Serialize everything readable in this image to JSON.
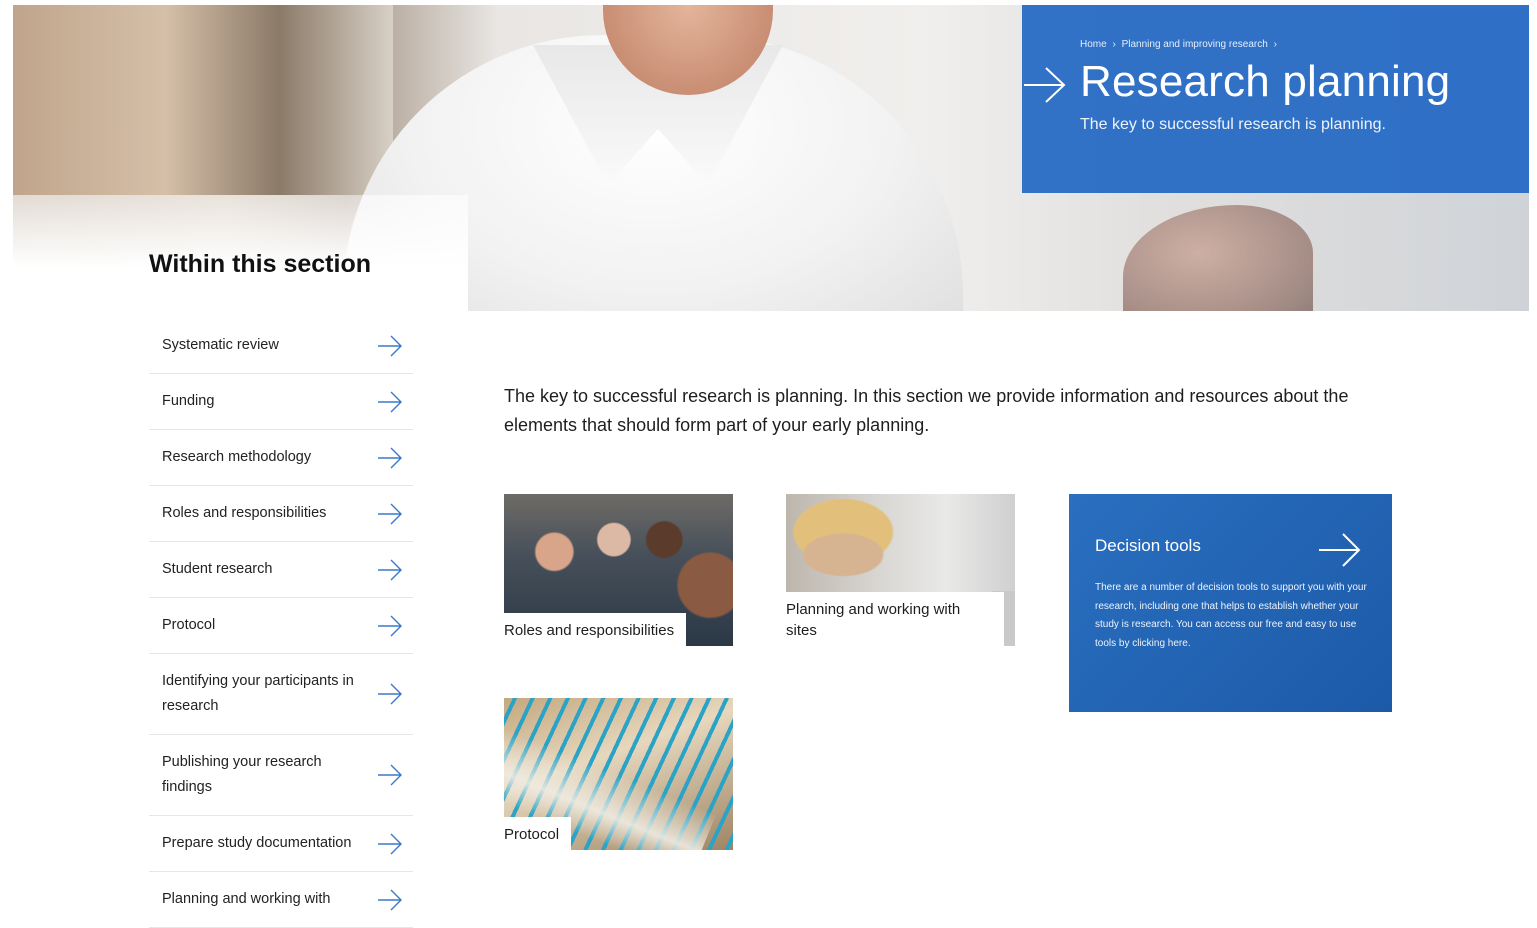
{
  "hero": {
    "breadcrumb": [
      "Home",
      "›",
      "Planning and improving research",
      "›"
    ],
    "title": "Research planning",
    "subtitle": "The key to successful research is planning.",
    "panel_color": "#2268c4"
  },
  "sidebar": {
    "heading": "Within this section",
    "items": [
      {
        "label": "Systematic review",
        "icon": "arrow-right-icon"
      },
      {
        "label": "Funding",
        "icon": "arrow-right-icon"
      },
      {
        "label": "Research methodology",
        "icon": "arrow-right-icon"
      },
      {
        "label": "Roles and responsibilities",
        "icon": "arrow-right-icon"
      },
      {
        "label": "Student research",
        "icon": "arrow-right-icon"
      },
      {
        "label": "Protocol",
        "icon": "arrow-right-icon"
      },
      {
        "label": "Identifying your participants in research",
        "icon": "arrow-right-icon"
      },
      {
        "label": "Publishing your research findings",
        "icon": "arrow-right-icon"
      },
      {
        "label": "Prepare study documentation",
        "icon": "arrow-right-icon"
      },
      {
        "label": "Planning and working with",
        "icon": "arrow-right-icon"
      }
    ]
  },
  "main": {
    "intro": "The key to successful research is planning. In this section we provide information and resources about the elements that should form part of your early planning.",
    "cards": [
      {
        "label": "Roles and responsibilities"
      },
      {
        "label": "Planning and working with sites"
      },
      {
        "label": "Protocol"
      }
    ],
    "decision": {
      "title": "Decision tools",
      "text": "There are a number of decision tools to support you with your research, including one that helps to establish whether your study is research. You can access our free and easy to use tools by clicking here.",
      "icon": "arrow-right-icon"
    }
  },
  "colors": {
    "accent": "#2268c4",
    "arrow": "#3a78c9"
  }
}
